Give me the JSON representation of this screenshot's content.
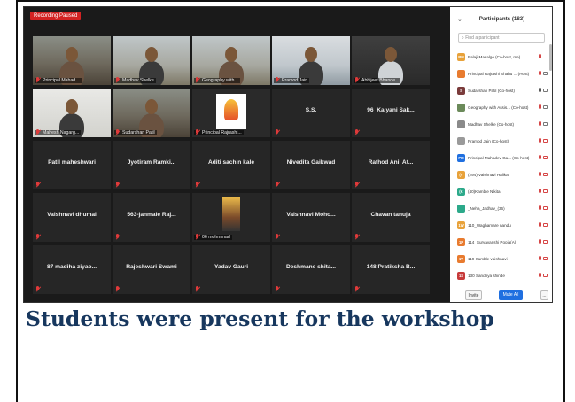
{
  "recording_badge": "Recording Paused",
  "tiles": [
    {
      "name": "Principal Mahad...",
      "video": "office"
    },
    {
      "name": "Madhav Shelke",
      "video": "room"
    },
    {
      "name": "Geography with...",
      "video": "room"
    },
    {
      "name": "Pramod Jain",
      "video": "blue"
    },
    {
      "name": "Abhijeet Bhande...",
      "video": "dark"
    },
    {
      "name": "Mahesh Nagarg...",
      "video": "light"
    },
    {
      "name": "Sudarshan Patil",
      "video": "office",
      "active": true
    },
    {
      "name": "Principal Rajrashi...",
      "video": "logo"
    },
    {
      "name": "S.S.",
      "video": "none"
    },
    {
      "name": "96_Kalyani Sak...",
      "video": "none"
    },
    {
      "name": "Patil maheshwari",
      "video": "none"
    },
    {
      "name": "Jyotiram Ramki...",
      "video": "none"
    },
    {
      "name": "Aditi sachin kale",
      "video": "none"
    },
    {
      "name": "Nivedita Gaikwad",
      "video": "none"
    },
    {
      "name": "Rathod Anil At...",
      "video": "none"
    },
    {
      "name": "Vaishnavi dhumal",
      "video": "none"
    },
    {
      "name": "563-janmale Raj...",
      "video": "none"
    },
    {
      "name": "06 mohmmad",
      "video": "city"
    },
    {
      "name": "Vaishnavi Moho...",
      "video": "none"
    },
    {
      "name": "Chavan tanuja",
      "video": "none"
    },
    {
      "name": "87 madiha ziyao...",
      "video": "none"
    },
    {
      "name": "Rajeshwari Swami",
      "video": "none"
    },
    {
      "name": "Yadav Gauri",
      "video": "none"
    },
    {
      "name": "Deshmane shita...",
      "video": "none"
    },
    {
      "name": "148 Pratiksha B...",
      "video": "none"
    }
  ],
  "panel": {
    "title": "Participants (183)",
    "search_placeholder": "Find a participant",
    "participants": [
      {
        "initials": "BM",
        "color": "#e8a23a",
        "name": "Balaji Masalge (Co-host, me)",
        "mic": "off",
        "cam": "none"
      },
      {
        "initials": "",
        "color": "#e87b2f",
        "name": "Principal Rajrashi Shahu ... (Host)",
        "mic": "off",
        "cam": "on"
      },
      {
        "initials": "S",
        "color": "#7a3b3b",
        "name": "Sudarshan Patil (Co-host)",
        "mic": "on",
        "cam": "on"
      },
      {
        "initials": "",
        "color": "#6b8a5a",
        "name": "Geography with Assis... (Co-host)",
        "mic": "off",
        "cam": "on"
      },
      {
        "initials": "",
        "color": "#8a8a8a",
        "name": "Madhav Shelke (Co-host)",
        "mic": "off",
        "cam": "on"
      },
      {
        "initials": "",
        "color": "#9a9a9a",
        "name": "Pramod Jain (Co-host)",
        "mic": "off",
        "cam": "off"
      },
      {
        "initials": "PM",
        "color": "#1f6fe0",
        "name": "Principal Mahadev Ga... (Co-host)",
        "mic": "off",
        "cam": "off"
      },
      {
        "initials": "(V",
        "color": "#e8a23a",
        "name": "(294) Vaishnavi Halikar",
        "mic": "off",
        "cam": "off"
      },
      {
        "initials": "(K",
        "color": "#2ca98a",
        "name": "(40)Kamble Nikita",
        "mic": "off",
        "cam": "off"
      },
      {
        "initials": "",
        "color": "#2ca98a",
        "name": "_Neha_Jadhav_(36)",
        "mic": "off",
        "cam": "off"
      },
      {
        "initials": "1W",
        "color": "#e8a23a",
        "name": "110_Waghamare nandu",
        "mic": "off",
        "cam": "off"
      },
      {
        "initials": "1P",
        "color": "#e87b2f",
        "name": "114_Suryavanshi Pooja(A)",
        "mic": "off",
        "cam": "off"
      },
      {
        "initials": "1V",
        "color": "#e87b2f",
        "name": "119 Kamble vaishnavi",
        "mic": "off",
        "cam": "off"
      },
      {
        "initials": "1S",
        "color": "#c73a3a",
        "name": "130 Sandhya shinde",
        "mic": "off",
        "cam": "off"
      }
    ],
    "invite_label": "Invite",
    "mute_all_label": "Mute All",
    "more_label": "..."
  },
  "caption": "Students were present for the workshop"
}
